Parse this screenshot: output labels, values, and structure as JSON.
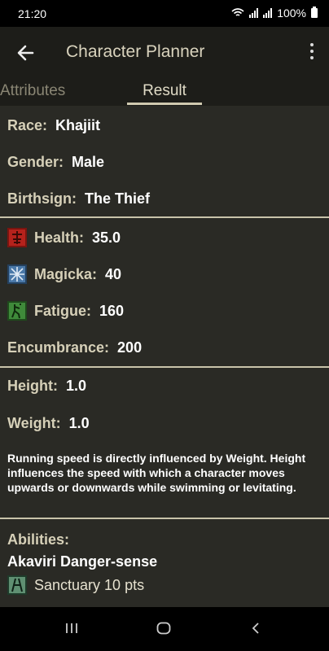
{
  "status": {
    "time": "21:20",
    "battery": "100%"
  },
  "appbar": {
    "title": "Character Planner"
  },
  "tabs": [
    {
      "label": "Attributes"
    },
    {
      "label": "Result"
    }
  ],
  "profile": {
    "race_label": "Race:",
    "race": "Khajiit",
    "gender_label": "Gender:",
    "gender": "Male",
    "birthsign_label": "Birthsign:",
    "birthsign": "The Thief"
  },
  "stats": {
    "health_label": "Health:",
    "health": "35.0",
    "magicka_label": "Magicka:",
    "magicka": "40",
    "fatigue_label": "Fatigue:",
    "fatigue": "160",
    "encumbrance_label": "Encumbrance:",
    "encumbrance": "200"
  },
  "body": {
    "height_label": "Height:",
    "height": "1.0",
    "weight_label": "Weight:",
    "weight": "1.0",
    "note": "Running speed is directly influenced by Weight. Height influences the speed with which a character moves upwards or downwards while swimming or levitating."
  },
  "abilities": {
    "label": "Abilities:",
    "name": "Akaviri Danger-sense",
    "spell": "Sanctuary 10 pts"
  },
  "icons": {
    "health": "health-icon",
    "magicka": "magicka-icon",
    "fatigue": "fatigue-icon",
    "sanctuary": "sanctuary-icon"
  },
  "colors": {
    "health": "#b5221c",
    "magicka": "#4a78a8",
    "fatigue": "#3f8a3a"
  }
}
